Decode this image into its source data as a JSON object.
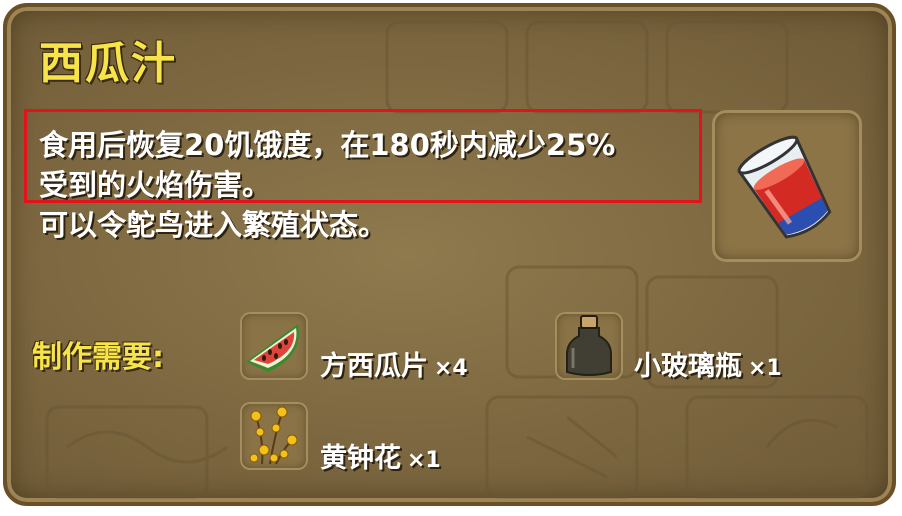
{
  "item": {
    "name": "西瓜汁",
    "description_lines": [
      "食用后恢复20饥饿度，在180秒内减少25%",
      "受到的火焰伤害。",
      "可以令鸵鸟进入繁殖状态。"
    ],
    "icon": "watermelon-juice-glass-icon"
  },
  "recipe": {
    "label": "制作需要:",
    "ingredients": [
      {
        "name": "方西瓜片",
        "count": "×4",
        "icon": "watermelon-slice-icon"
      },
      {
        "name": "小玻璃瓶",
        "count": "×1",
        "icon": "glass-bottle-icon"
      },
      {
        "name": "黄钟花",
        "count": "×1",
        "icon": "yellow-bellflower-icon"
      }
    ]
  },
  "colors": {
    "title": "#f6e44a",
    "highlight_border": "#e3121b",
    "panel": "#7c6740"
  }
}
